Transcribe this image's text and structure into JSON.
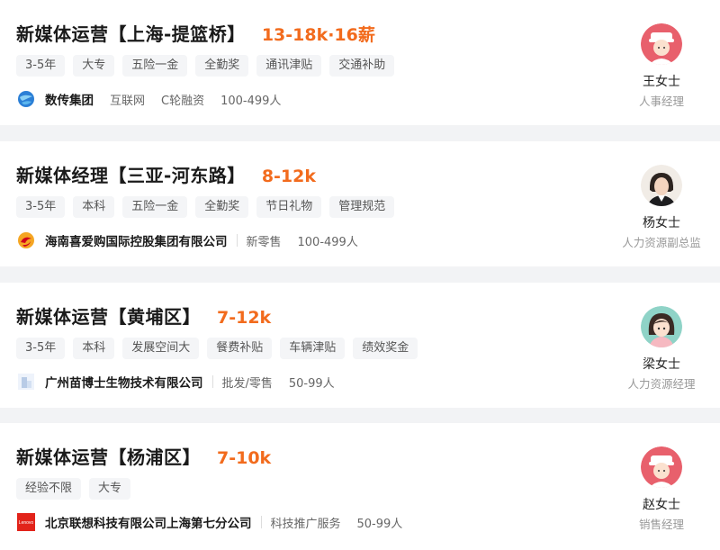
{
  "jobs": [
    {
      "title": "新媒体运营【上海-提篮桥】",
      "salary": "13-18k·16薪",
      "tags": [
        "3-5年",
        "大专",
        "五险一金",
        "全勤奖",
        "通讯津贴",
        "交通补助"
      ],
      "company": "数传集团",
      "company_logo": "globe-logo-icon",
      "industry": "互联网",
      "funding": "C轮融资",
      "size": "100-499人",
      "recruiter_name": "王女士",
      "recruiter_role": "人事经理"
    },
    {
      "title": "新媒体经理【三亚-河东路】",
      "salary": "8-12k",
      "tags": [
        "3-5年",
        "本科",
        "五险一金",
        "全勤奖",
        "节日礼物",
        "管理规范"
      ],
      "company": "海南喜爱购国际控股集团有限公司",
      "company_logo": "swirl-logo-icon",
      "industry": "新零售",
      "size": "100-499人",
      "recruiter_name": "杨女士",
      "recruiter_role": "人力资源副总监"
    },
    {
      "title": "新媒体运营【黄埔区】",
      "salary": "7-12k",
      "tags": [
        "3-5年",
        "本科",
        "发展空间大",
        "餐费补贴",
        "车辆津贴",
        "绩效奖金"
      ],
      "company": "广州苗博士生物技术有限公司",
      "company_logo": "building-logo-icon",
      "industry": "批发/零售",
      "size": "50-99人",
      "recruiter_name": "梁女士",
      "recruiter_role": "人力资源经理"
    },
    {
      "title": "新媒体运营【杨浦区】",
      "salary": "7-10k",
      "tags": [
        "经验不限",
        "大专"
      ],
      "company": "北京联想科技有限公司上海第七分公司",
      "company_logo": "lenovo-logo-icon",
      "company_logo_text": "Lenovo",
      "industry": "科技推广服务",
      "size": "50-99人",
      "recruiter_name": "赵女士",
      "recruiter_role": "销售经理"
    }
  ],
  "colors": {
    "salary": "#f26b1d",
    "tag_bg": "#f4f5f7",
    "card_bg": "#ffffff",
    "page_bg": "#f2f3f5"
  }
}
